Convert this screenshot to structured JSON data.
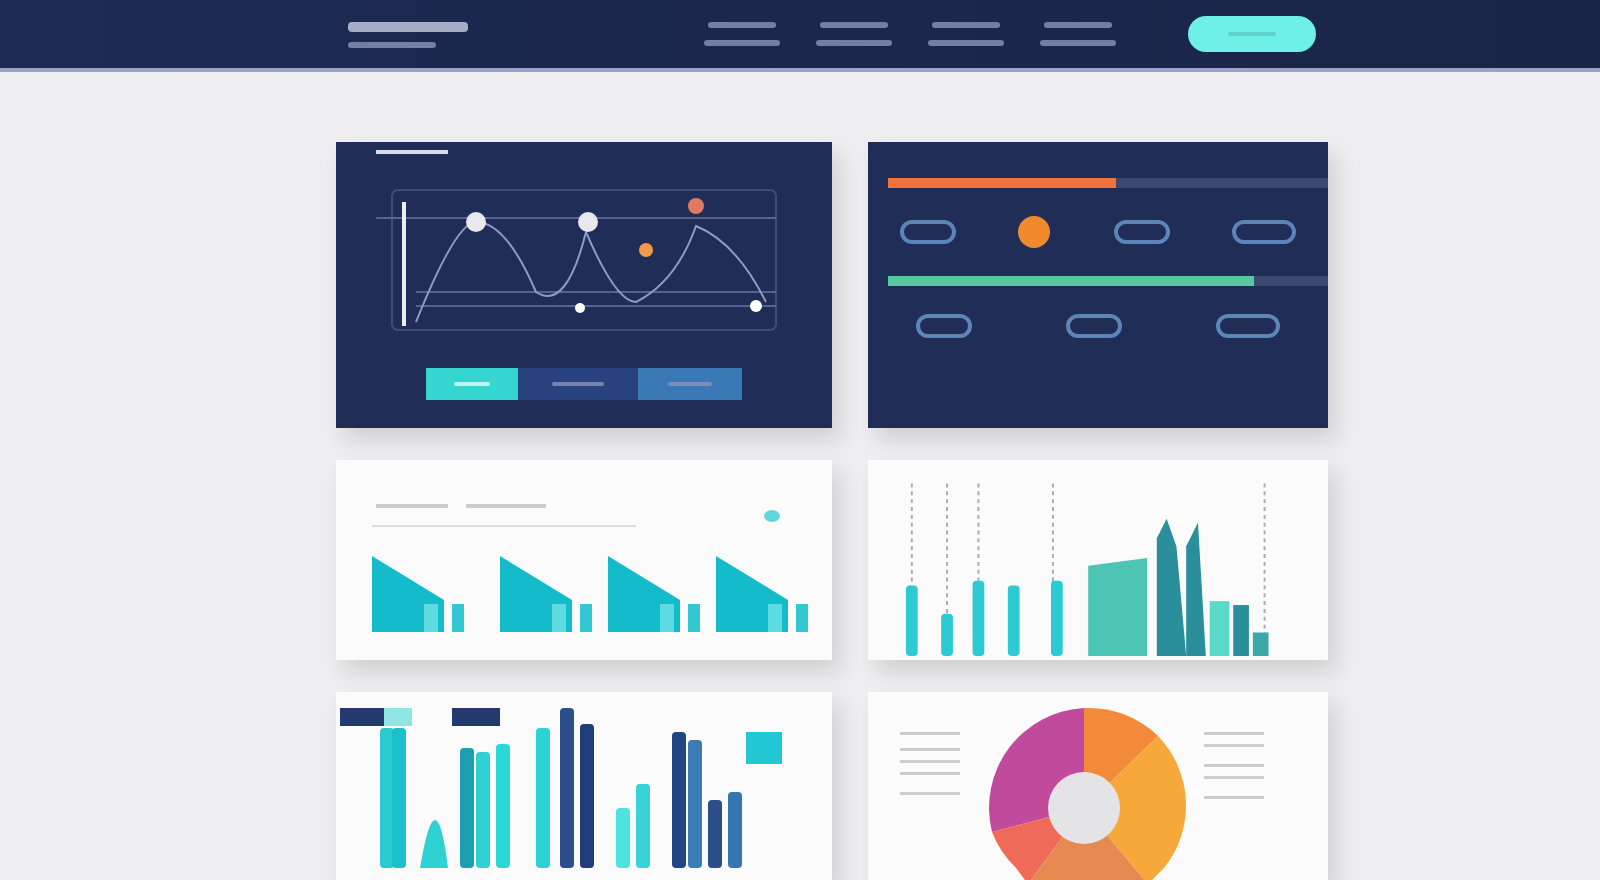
{
  "panels": [
    {
      "kind": "line"
    },
    {
      "kind": "controls",
      "sliders": [
        {
          "level": 0.52,
          "color": "#f0743a"
        },
        {
          "level": 0.83,
          "color": "#5ac8a0"
        }
      ]
    },
    {
      "kind": "mountains"
    },
    {
      "kind": "skyline"
    },
    {
      "kind": "bars"
    },
    {
      "kind": "donut"
    }
  ]
}
